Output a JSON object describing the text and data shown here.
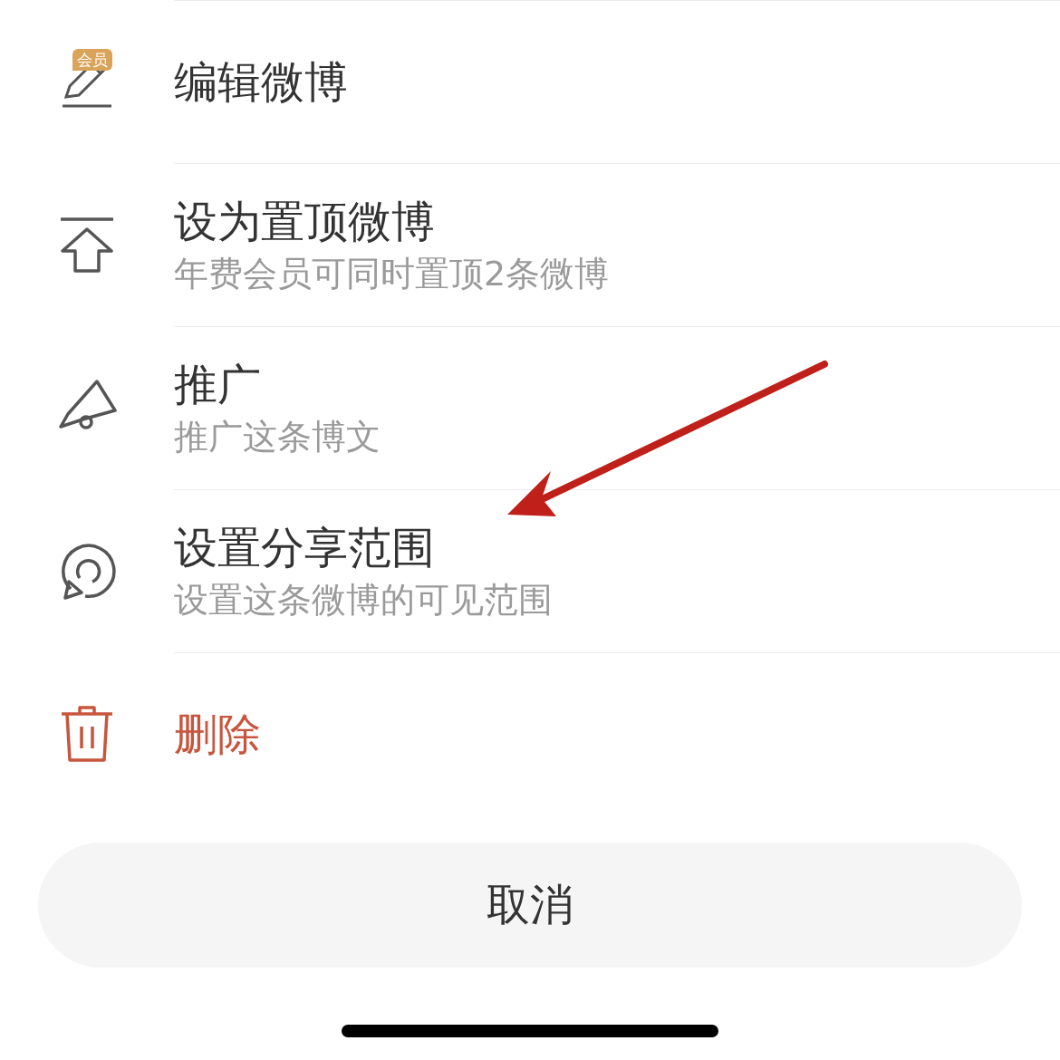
{
  "menu": {
    "items": [
      {
        "kind": "edit",
        "title": "编辑微博",
        "badge": "会员"
      },
      {
        "kind": "pin",
        "title": "设为置顶微博",
        "subtitle": "年费会员可同时置顶2条微博"
      },
      {
        "kind": "promote",
        "title": "推广",
        "subtitle": "推广这条博文"
      },
      {
        "kind": "share_scope",
        "title": "设置分享范围",
        "subtitle": "设置这条微博的可见范围"
      },
      {
        "kind": "delete",
        "title": "删除"
      }
    ]
  },
  "cancel_button": {
    "label": "取消"
  }
}
